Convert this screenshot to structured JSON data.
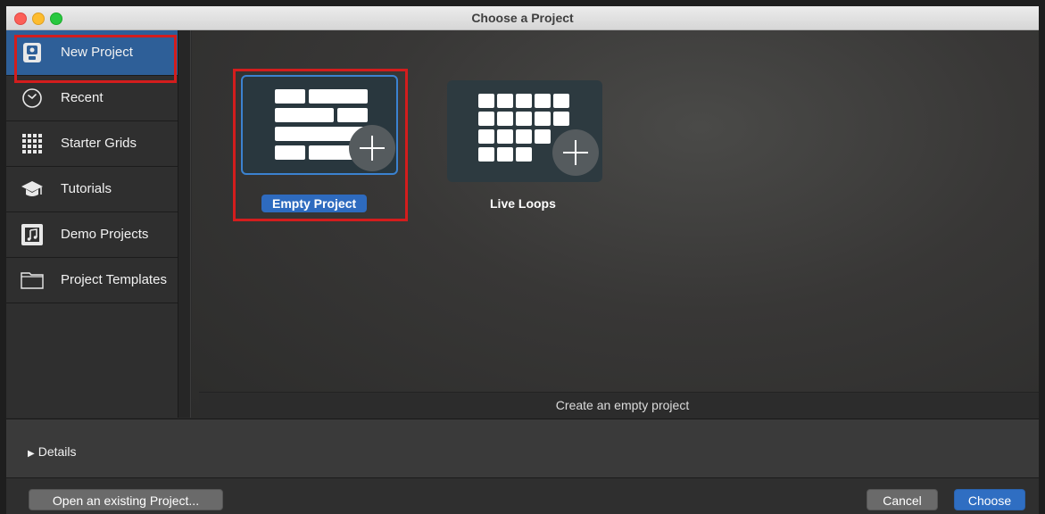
{
  "window": {
    "title": "Choose a Project"
  },
  "sidebar": {
    "items": [
      {
        "label": "New Project",
        "icon": "new-project-icon"
      },
      {
        "label": "Recent",
        "icon": "clock-icon"
      },
      {
        "label": "Starter Grids",
        "icon": "grid-icon"
      },
      {
        "label": "Tutorials",
        "icon": "graduation-cap-icon"
      },
      {
        "label": "Demo Projects",
        "icon": "music-note-icon"
      },
      {
        "label": "Project Templates",
        "icon": "folder-icon"
      }
    ],
    "selected_index": 0
  },
  "projects": [
    {
      "label": "Empty Project",
      "icon": "empty-project-icon",
      "selected": true
    },
    {
      "label": "Live Loops",
      "icon": "live-loops-icon",
      "selected": false
    }
  ],
  "status": {
    "text": "Create an empty project"
  },
  "details": {
    "label": "Details"
  },
  "footer": {
    "open_existing_label": "Open an existing Project...",
    "cancel_label": "Cancel",
    "choose_label": "Choose"
  },
  "colors": {
    "accent": "#2f6ec2",
    "selection": "#2e5f98",
    "highlight_box": "#d31d1d"
  }
}
